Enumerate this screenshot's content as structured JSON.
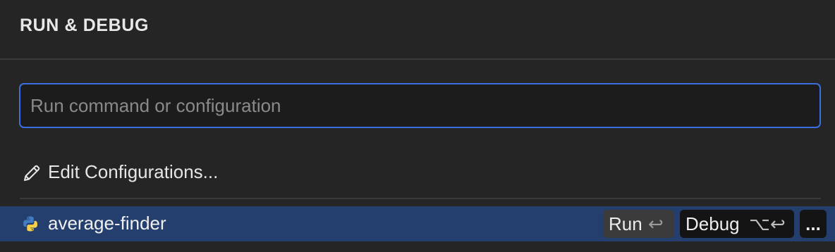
{
  "header": {
    "title": "RUN & DEBUG"
  },
  "search": {
    "placeholder": "Run command or configuration",
    "value": ""
  },
  "edit": {
    "icon": "pencil-icon",
    "label": "Edit Configurations..."
  },
  "config": {
    "icon": "python-icon",
    "name": "average-finder",
    "run_label": "Run",
    "run_shortcut": "↩",
    "debug_label": "Debug",
    "debug_shortcut": "⌥↩",
    "more_label": "..."
  },
  "colors": {
    "background": "#252525",
    "accent_border": "#3b6ee0",
    "selected_row": "#243f6e"
  }
}
